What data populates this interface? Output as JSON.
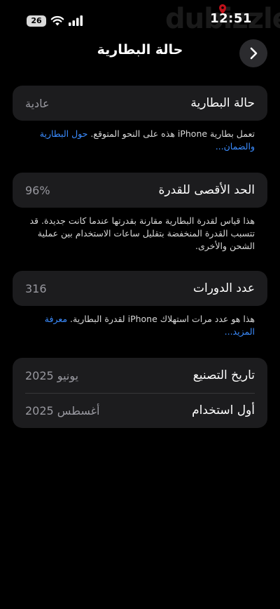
{
  "status_bar": {
    "battery_level": "26",
    "time": "12:51",
    "watermark": "dubizzle",
    "icons": [
      "wifi-icon",
      "signal-icon"
    ]
  },
  "nav": {
    "title": "حالة البطارية",
    "forward_icon": "chevron-right-icon"
  },
  "battery_health": {
    "label": "حالة البطارية",
    "value": "عادية",
    "note_text": "تعمل بطارية iPhone هذه على النحو المتوقع. ",
    "note_link": "حول البطارية والضمان..."
  },
  "maximum_capacity": {
    "label": "الحد الأقصى للقدرة",
    "value": "96%",
    "note_text": "هذا قياس لقدرة البطارية مقارنة بقدرتها عندما كانت جديدة. قد تتسبب القدرة المنخفضة بتقليل ساعات الاستخدام بين عملية الشحن والأخرى."
  },
  "cycle_count": {
    "label": "عدد الدورات",
    "value": "316",
    "note_text": "هذا هو عدد مرات استهلاك iPhone لقدرة البطارية. ",
    "note_link": "معرفة المزيد..."
  },
  "dates": {
    "manufacture_label": "تاريخ التصنيع",
    "manufacture_value": "يونيو 2025",
    "first_use_label": "أول استخدام",
    "first_use_value": "أغسطس 2025"
  },
  "colors": {
    "background": "#000000",
    "card": "#1c1c1e",
    "secondary_text": "#98989f",
    "link": "#3b8cff"
  }
}
